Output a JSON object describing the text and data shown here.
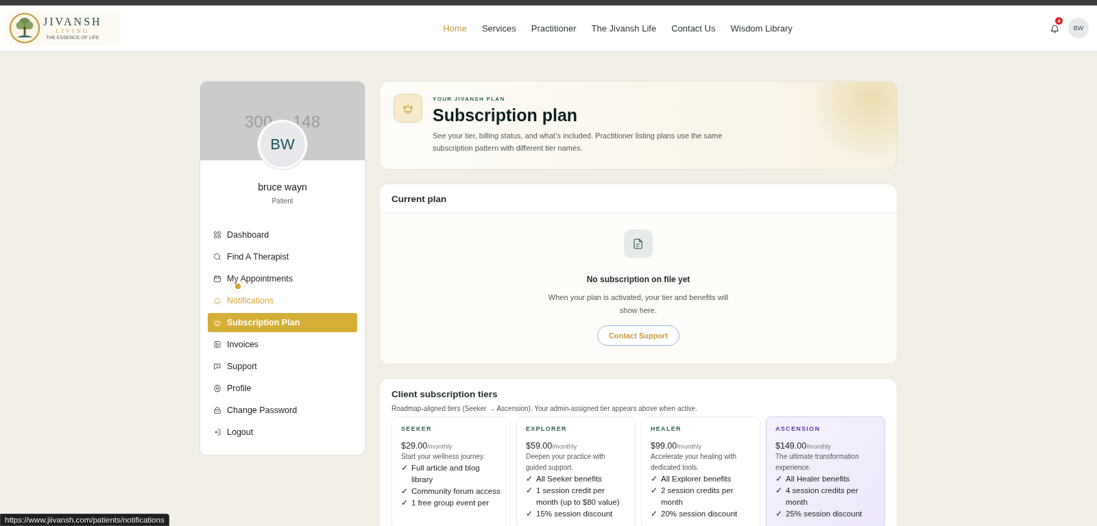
{
  "logo": {
    "name": "JIVANSH",
    "sub": "LIVING",
    "tagline": "THE ESSENCE OF LIFE"
  },
  "nav": [
    {
      "label": "Home",
      "selected": true
    },
    {
      "label": "Services",
      "selected": false
    },
    {
      "label": "Practitioner",
      "selected": false
    },
    {
      "label": "The Jivansh Life",
      "selected": false
    },
    {
      "label": "Contact Us",
      "selected": false
    },
    {
      "label": "Wisdom Library",
      "selected": false
    }
  ],
  "notifications": {
    "count": "4"
  },
  "user_avatar": "BW",
  "profile": {
    "cover_text": [
      "300",
      "148"
    ],
    "initials": "BW",
    "name": "bruce wayn",
    "role": "Patient"
  },
  "sidebar": {
    "items": [
      {
        "label": "Dashboard",
        "kind": "grid",
        "selected": false,
        "hovered": false
      },
      {
        "label": "Find A Therapist",
        "kind": "search",
        "selected": false,
        "hovered": false
      },
      {
        "label": "My Appointments",
        "kind": "calendar",
        "selected": false,
        "hovered": false
      },
      {
        "label": "Notifications",
        "kind": "bell",
        "selected": false,
        "hovered": true
      },
      {
        "label": "Subscription Plan",
        "kind": "crown",
        "selected": true,
        "hovered": false
      },
      {
        "label": "Invoices",
        "kind": "invoice",
        "selected": false,
        "hovered": false
      },
      {
        "label": "Support",
        "kind": "chat",
        "selected": false,
        "hovered": false
      },
      {
        "label": "Profile",
        "kind": "gear",
        "selected": false,
        "hovered": false
      },
      {
        "label": "Change Password",
        "kind": "lock",
        "selected": false,
        "hovered": false
      },
      {
        "label": "Logout",
        "kind": "logout",
        "selected": false,
        "hovered": false
      }
    ]
  },
  "hero": {
    "eyebrow": "YOUR JIVANSH PLAN",
    "title": "Subscription plan",
    "description": "See your tier, billing status, and what’s included. Practitioner listing plans use the same subscription pattern with different tier names."
  },
  "current_plan": {
    "title": "Current plan",
    "empty_title": "No subscription on file yet",
    "empty_text": "When your plan is activated, your tier and benefits will show here.",
    "button": "Contact Support"
  },
  "tiers": {
    "title": "Client subscription tiers",
    "subtitle": "Roadmap-aligned tiers (Seeker → Ascension). Your admin-assigned tier appears above when active.",
    "items": [
      {
        "name": "SEEKER",
        "price": "$29.00",
        "period": "/monthly",
        "description": "Start your wellness journey.",
        "highlighted": false,
        "features": [
          "Full article and blog library",
          "Community forum access",
          "1 free group event per"
        ]
      },
      {
        "name": "EXPLORER",
        "price": "$59.00",
        "period": "/monthly",
        "description": "Deepen your practice with guided support.",
        "highlighted": false,
        "features": [
          "All Seeker benefits",
          "1 session credit per month (up to $80 value)",
          "15% session discount"
        ]
      },
      {
        "name": "HEALER",
        "price": "$99.00",
        "period": "/monthly",
        "description": "Accelerate your healing with dedicated tools.",
        "highlighted": false,
        "features": [
          "All Explorer benefits",
          "2 session credits per month",
          "20% session discount"
        ]
      },
      {
        "name": "ASCENSION",
        "price": "$149.00",
        "period": "/monthly",
        "description": "The ultimate transformation experience.",
        "highlighted": true,
        "features": [
          "All Healer benefits",
          "4 session credits per month",
          "25% session discount"
        ]
      }
    ]
  },
  "check_mark": "✓",
  "status_url": "https://www.jiivansh.com/patients/notifications"
}
